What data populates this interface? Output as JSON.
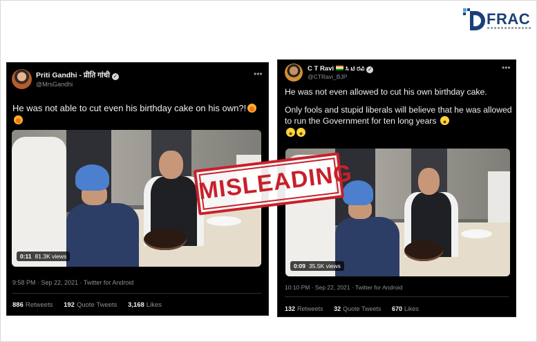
{
  "logo": {
    "text": "FRAC",
    "icon": "dfrac-d-icon"
  },
  "stamp": {
    "label": "MISLEADING",
    "color": "#c8202a"
  },
  "tweets": [
    {
      "author_name": "Priti Gandhi - प्रीति गांधी",
      "handle": "@MrsGandhi",
      "text": "He was not able to cut even his birthday cake on his own?!",
      "video_duration": "0:11",
      "video_views": "81.3K views",
      "timestamp": "9:58 PM · Sep 22, 2021 · Twitter for Android",
      "retweets": "886",
      "retweets_label": "Retweets",
      "quote_tweets": "192",
      "quote_tweets_label": "Quote Tweets",
      "likes": "3,168",
      "likes_label": "Likes"
    },
    {
      "author_name": "C T Ravi",
      "author_name_native": "ಸಿ ಟಿ ರವಿ",
      "handle": "@CTRavi_BJP",
      "text_line1": "He was not even allowed to cut his own birthday cake.",
      "text_line2": "Only fools and stupid liberals will believe that he was allowed to run the Government for ten long years",
      "video_duration": "0:09",
      "video_views": "35.5K views",
      "timestamp": "10:10 PM · Sep 22, 2021 · Twitter for Android",
      "retweets": "132",
      "retweets_label": "Retweets",
      "quote_tweets": "32",
      "quote_tweets_label": "Quote Tweets",
      "likes": "670",
      "likes_label": "Likes"
    }
  ],
  "colors": {
    "tweet_bg": "#000000",
    "brand": "#1b3f7a",
    "stamp_red": "#c8202a"
  }
}
